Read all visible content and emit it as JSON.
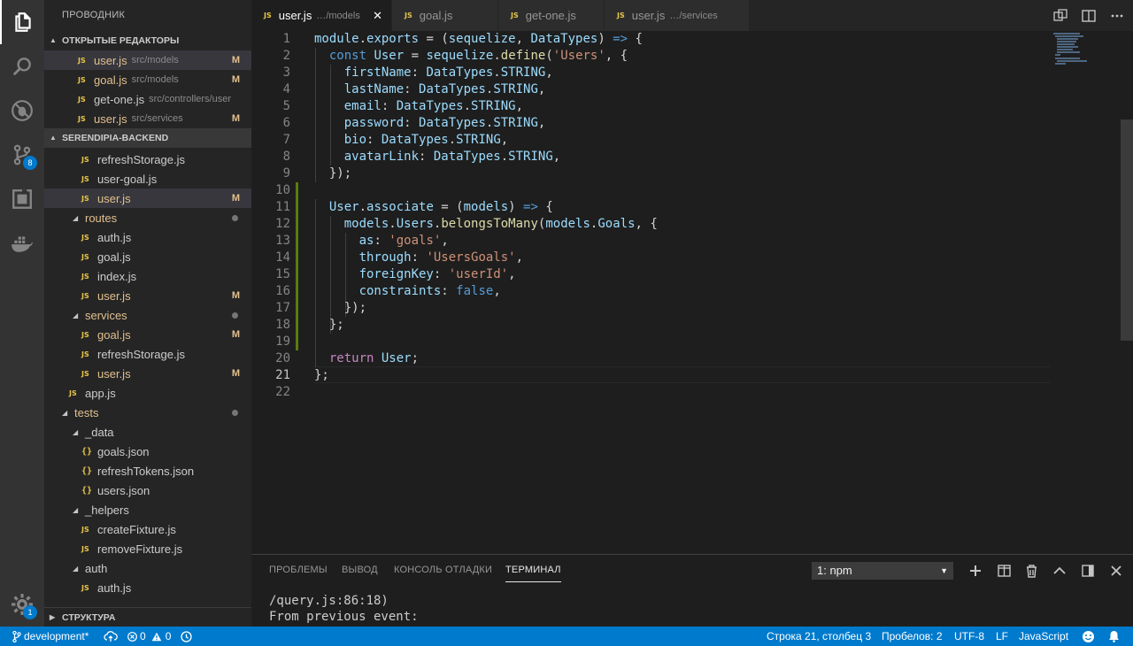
{
  "sidebar": {
    "title": "ПРОВОДНИК",
    "open_editors_title": "ОТКРЫТЫЕ РЕДАКТОРЫ",
    "open_editors": [
      {
        "name": "user.js",
        "path": "src/models",
        "status": "M"
      },
      {
        "name": "goal.js",
        "path": "src/models",
        "status": "M"
      },
      {
        "name": "get-one.js",
        "path": "src/controllers/user",
        "status": ""
      },
      {
        "name": "user.js",
        "path": "src/services",
        "status": "M"
      }
    ],
    "project_title": "SERENDIPIA-BACKEND",
    "tree": [
      {
        "name": "refreshStorage.js",
        "status": ""
      },
      {
        "name": "user-goal.js",
        "status": ""
      },
      {
        "name": "user.js",
        "status": "M"
      },
      {
        "name": "routes",
        "status": ""
      },
      {
        "name": "auth.js",
        "status": ""
      },
      {
        "name": "goal.js",
        "status": ""
      },
      {
        "name": "index.js",
        "status": ""
      },
      {
        "name": "user.js",
        "status": "M"
      },
      {
        "name": "services",
        "status": ""
      },
      {
        "name": "goal.js",
        "status": "M"
      },
      {
        "name": "refreshStorage.js",
        "status": ""
      },
      {
        "name": "user.js",
        "status": "M"
      },
      {
        "name": "app.js",
        "status": ""
      },
      {
        "name": "tests",
        "status": ""
      },
      {
        "name": "_data",
        "status": ""
      },
      {
        "name": "goals.json",
        "status": ""
      },
      {
        "name": "refreshTokens.json",
        "status": ""
      },
      {
        "name": "users.json",
        "status": ""
      },
      {
        "name": "_helpers",
        "status": ""
      },
      {
        "name": "createFixture.js",
        "status": ""
      },
      {
        "name": "removeFixture.js",
        "status": ""
      },
      {
        "name": "auth",
        "status": ""
      },
      {
        "name": "auth.js",
        "status": ""
      }
    ],
    "structure_title": "СТРУКТУРА"
  },
  "activity": {
    "icons": [
      "files-icon",
      "search-icon",
      "debug-icon",
      "source-control-icon",
      "extensions-icon",
      "docker-icon",
      "settings-icon"
    ],
    "scm_badge": "8",
    "settings_badge": "1"
  },
  "tabs": [
    {
      "name": "user.js",
      "path": "…/models"
    },
    {
      "name": "goal.js",
      "path": ""
    },
    {
      "name": "get-one.js",
      "path": ""
    },
    {
      "name": "user.js",
      "path": "…/services"
    }
  ],
  "editor": {
    "line_numbers": [
      "1",
      "2",
      "3",
      "4",
      "5",
      "6",
      "7",
      "8",
      "9",
      "10",
      "11",
      "12",
      "13",
      "14",
      "15",
      "16",
      "17",
      "18",
      "19",
      "20",
      "21",
      "22"
    ],
    "code": {
      "l1_a": "module",
      "l1_b": ".",
      "l1_c": "exports",
      "l1_d": " = (",
      "l1_e": "sequelize",
      "l1_f": ", ",
      "l1_g": "DataTypes",
      "l1_h": ") ",
      "l1_i": "=>",
      "l1_j": " {",
      "l2_a": "  ",
      "l2_b": "const",
      "l2_c": " ",
      "l2_d": "User",
      "l2_e": " = ",
      "l2_f": "sequelize",
      "l2_g": ".",
      "l2_h": "define",
      "l2_i": "(",
      "l2_j": "'Users'",
      "l2_k": ", {",
      "l3_a": "    ",
      "l3_b": "firstName",
      "l3_c": ": ",
      "l3_d": "DataTypes",
      "l3_e": ".",
      "l3_f": "STRING",
      "l3_g": ",",
      "l4_a": "    ",
      "l4_b": "lastName",
      "l4_c": ": ",
      "l4_d": "DataTypes",
      "l4_e": ".",
      "l4_f": "STRING",
      "l4_g": ",",
      "l5_a": "    ",
      "l5_b": "email",
      "l5_c": ": ",
      "l5_d": "DataTypes",
      "l5_e": ".",
      "l5_f": "STRING",
      "l5_g": ",",
      "l6_a": "    ",
      "l6_b": "password",
      "l6_c": ": ",
      "l6_d": "DataTypes",
      "l6_e": ".",
      "l6_f": "STRING",
      "l6_g": ",",
      "l7_a": "    ",
      "l7_b": "bio",
      "l7_c": ": ",
      "l7_d": "DataTypes",
      "l7_e": ".",
      "l7_f": "STRING",
      "l7_g": ",",
      "l8_a": "    ",
      "l8_b": "avatarLink",
      "l8_c": ": ",
      "l8_d": "DataTypes",
      "l8_e": ".",
      "l8_f": "STRING",
      "l8_g": ",",
      "l9": "  });",
      "l11_a": "  ",
      "l11_b": "User",
      "l11_c": ".",
      "l11_d": "associate",
      "l11_e": " = (",
      "l11_f": "models",
      "l11_g": ") ",
      "l11_h": "=>",
      "l11_i": " {",
      "l12_a": "    ",
      "l12_b": "models",
      "l12_c": ".",
      "l12_d": "Users",
      "l12_e": ".",
      "l12_f": "belongsToMany",
      "l12_g": "(",
      "l12_h": "models",
      "l12_i": ".",
      "l12_j": "Goals",
      "l12_k": ", {",
      "l13_a": "      ",
      "l13_b": "as",
      "l13_c": ": ",
      "l13_d": "'goals'",
      "l13_e": ",",
      "l14_a": "      ",
      "l14_b": "through",
      "l14_c": ": ",
      "l14_d": "'UsersGoals'",
      "l14_e": ",",
      "l15_a": "      ",
      "l15_b": "foreignKey",
      "l15_c": ": ",
      "l15_d": "'userId'",
      "l15_e": ",",
      "l16_a": "      ",
      "l16_b": "constraints",
      "l16_c": ": ",
      "l16_d": "false",
      "l16_e": ",",
      "l17": "    });",
      "l18": "  };",
      "l20_a": "  ",
      "l20_b": "return",
      "l20_c": " ",
      "l20_d": "User",
      "l20_e": ";",
      "l21": "};"
    }
  },
  "panel": {
    "tabs": [
      "ПРОБЛЕМЫ",
      "ВЫВОД",
      "КОНСОЛЬ ОТЛАДКИ",
      "ТЕРМИНАЛ"
    ],
    "terminal_select": "1: npm",
    "terminal_lines": [
      "/query.js:86:18)",
      "From previous event:"
    ]
  },
  "status": {
    "branch": "development*",
    "errors": "0",
    "warnings": "0",
    "position": "Строка 21, столбец 3",
    "spaces": "Пробелов: 2",
    "encoding": "UTF-8",
    "eol": "LF",
    "language": "JavaScript"
  },
  "colors": {
    "accent": "#007acc",
    "modified": "#e2c08d",
    "git_added": "#587c0c"
  }
}
